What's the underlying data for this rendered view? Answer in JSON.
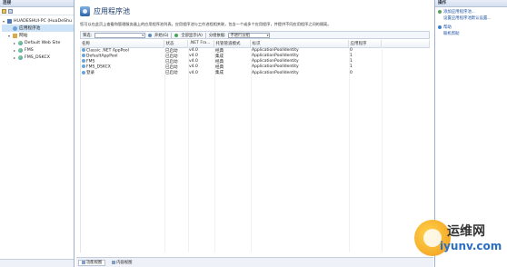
{
  "left": {
    "header": "连接",
    "tree": [
      {
        "label": "HUADESHUI-PC (HuaDeShu",
        "level": 0,
        "exp": "▾",
        "icon": "pc"
      },
      {
        "label": "应用程序池",
        "level": 1,
        "exp": "",
        "icon": "pool",
        "selected": true
      },
      {
        "label": "网站",
        "level": 1,
        "exp": "▾",
        "icon": "sites"
      },
      {
        "label": "Default Web Site",
        "level": 2,
        "exp": "▸",
        "icon": "globe"
      },
      {
        "label": "FMS",
        "level": 2,
        "exp": "▸",
        "icon": "globe"
      },
      {
        "label": "FMS_DSKCX",
        "level": 2,
        "exp": "▸",
        "icon": "globe"
      }
    ]
  },
  "center": {
    "title": "应用程序池",
    "description": "您可以在此页上查看和管理服务器上的应用程序池列表。应用程序池与工作进程相关联，包含一个或多个应用程序，并提供不同应用程序之间的隔离。",
    "filter": {
      "label": "筛选:",
      "go_label": "开始(G)",
      "show_all_label": "全部显示(A)",
      "group_label": "分组依据:",
      "group_value": "不进行分组"
    },
    "table": {
      "columns": [
        "名称",
        "状态",
        ".NET Fra...",
        "托管管道模式",
        "标识",
        "应用程序"
      ],
      "rows": [
        [
          "Classic .NET AppPool",
          "已启动",
          "v4.0",
          "经典",
          "ApplicationPoolIdentity",
          "0"
        ],
        [
          "DefaultAppPool",
          "已启动",
          "v4.0",
          "集成",
          "ApplicationPoolIdentity",
          "1"
        ],
        [
          "FMS",
          "已启动",
          "v4.0",
          "经典",
          "ApplicationPoolIdentity",
          "1"
        ],
        [
          "FMS_DSKCX",
          "已启动",
          "v4.0",
          "经典",
          "ApplicationPoolIdentity",
          "1"
        ],
        [
          "登录",
          "已启动",
          "v4.0",
          "集成",
          "ApplicationPoolIdentity",
          "0"
        ]
      ]
    },
    "view_tabs": [
      "功能视图",
      "内容视图"
    ]
  },
  "right": {
    "header": "操作",
    "actions": [
      {
        "label": "添加应用程序池...",
        "icon": "add"
      },
      {
        "label": "设置应用程序池默认设置...",
        "icon": "none"
      },
      {
        "label": "帮助",
        "icon": "help"
      },
      {
        "label": "联机帮助",
        "icon": "none"
      }
    ]
  },
  "watermark": {
    "chinese": "运维网",
    "domain": "iyunv.com"
  }
}
